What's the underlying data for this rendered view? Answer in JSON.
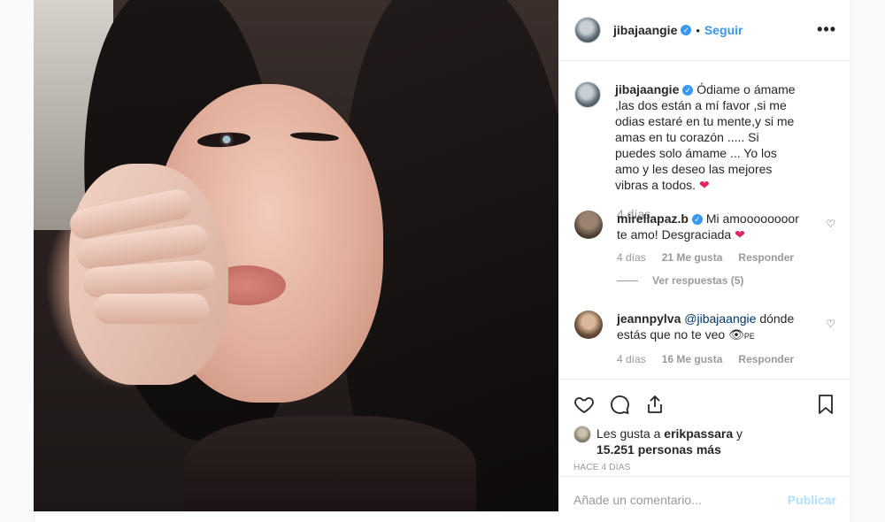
{
  "post": {
    "author": "jibajaangie",
    "follow_label": "Seguir",
    "separator": "•",
    "more_icon": "•••"
  },
  "caption": {
    "username": "jibajaangie",
    "text": "Ódiame o ámame ,las dos están a mí favor ,si me odias estaré en tu mente,y si me amas en tu corazón ..... Si puedes solo ámame ... Yo los amo y les deseo las mejores vibras a todos.",
    "emoji": "❤",
    "age": "4 días"
  },
  "comments": [
    {
      "username": "mirellapaz.b",
      "text": "Mi amoooooooor te amo! Desgraciada",
      "emoji": "❤",
      "age": "4 días",
      "likes": "21 Me gusta",
      "reply_label": "Responder",
      "view_replies": "Ver respuestas (5)"
    },
    {
      "username": "jeannpylva",
      "mention": "@jibajaangie",
      "text": "dónde estás que no te veo",
      "emoji": "👁",
      "trail": "PE",
      "age": "4 días",
      "likes": "16 Me gusta",
      "reply_label": "Responder"
    }
  ],
  "engagement": {
    "liked_prefix": "Les gusta a",
    "liked_by": "erikpassara",
    "liked_and": "y",
    "others": "15.251 personas más",
    "timestamp": "HACE 4 DÍAS"
  },
  "composer": {
    "placeholder": "Añade un comentario...",
    "publish_label": "Publicar"
  },
  "colors": {
    "accent": "#3897f0",
    "heart": "#e0245e",
    "muted": "#999999",
    "publish_disabled": "#b2dffc"
  }
}
